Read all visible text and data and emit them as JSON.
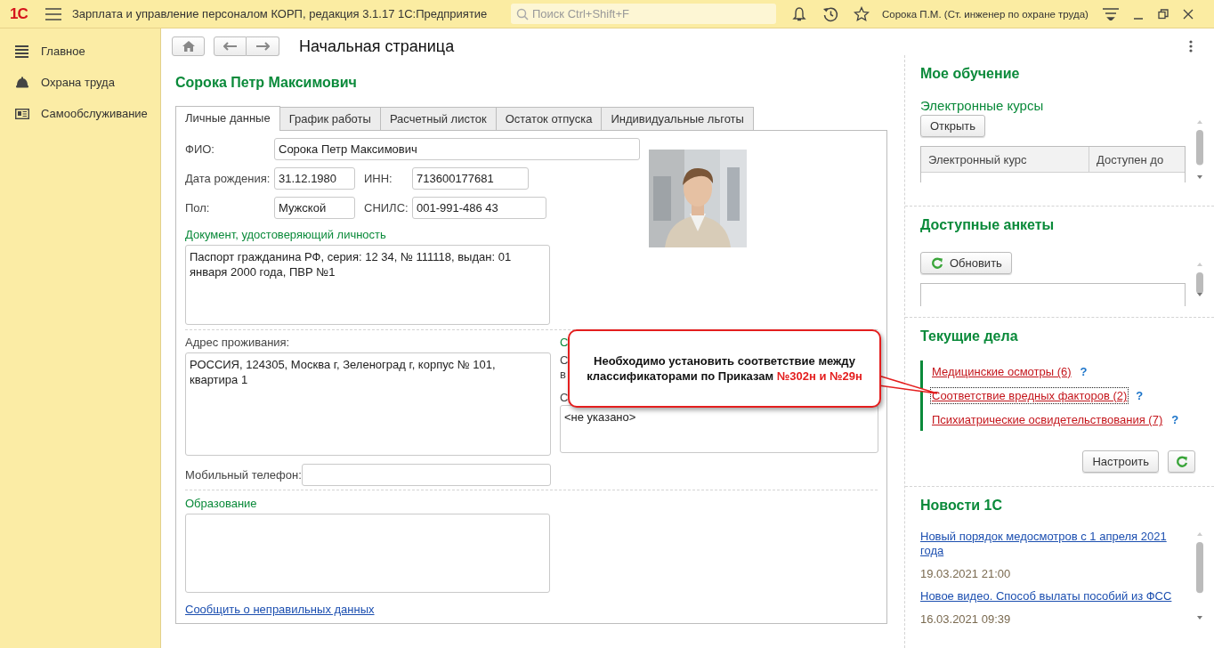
{
  "app": {
    "logo": "1С",
    "title": "Зарплата и управление персоналом КОРП, редакция 3.1.17 1С:Предприятие",
    "search": {
      "placeholder": "Поиск Ctrl+Shift+F"
    },
    "user": "Сорока П.М. (Ст. инженер по охране труда)"
  },
  "sidebar": {
    "items": [
      {
        "label": "Главное"
      },
      {
        "label": "Охрана труда"
      },
      {
        "label": "Самообслуживание"
      }
    ]
  },
  "page_title": "Начальная страница",
  "employee": {
    "name": "Сорока Петр Максимович",
    "tabs": [
      {
        "label": "Личные данные",
        "selected": true
      },
      {
        "label": "График работы",
        "selected": false
      },
      {
        "label": "Расчетный листок",
        "selected": false
      },
      {
        "label": "Остаток отпуска",
        "selected": false
      },
      {
        "label": "Индивидуальные льготы",
        "selected": false
      }
    ],
    "fio": {
      "label": "ФИО:",
      "value": "Сорока Петр Максимович"
    },
    "birth_date": {
      "label": "Дата рождения:",
      "value": "31.12.1980"
    },
    "inn": {
      "label": "ИНН:",
      "value": "713600177681"
    },
    "gender": {
      "label": "Пол:",
      "value": "Мужской"
    },
    "snils": {
      "label": "СНИЛС:",
      "value": "001-991-486 43"
    },
    "document": {
      "heading": "Документ, удостоверяющий личность",
      "value": "Паспорт гражданина РФ, серия: 12 34, № 111118, выдан: 01 января 2000 года, ПВР №1"
    },
    "address": {
      "label": "Адрес проживания:",
      "value": "РОССИЯ, 124305, Москва г, Зеленоград г, корпус № 101, квартира 1"
    },
    "covered_column": {
      "heading": "С",
      "labels": [
        "С",
        "в",
        "С"
      ],
      "value": "<не указано>"
    },
    "phone": {
      "label": "Мобильный телефон:"
    },
    "education": {
      "heading": "Образование"
    },
    "report_link": "Сообщить о неправильных данных"
  },
  "callout": {
    "text": "Необходимо установить соответствие между классификаторами по Приказам",
    "highlight": "№302н и №29н"
  },
  "learning": {
    "heading": "Мое обучение",
    "subheading": "Электронные курсы",
    "button": "Открыть",
    "columns": [
      "Электронный курс",
      "Доступен до"
    ]
  },
  "surveys": {
    "heading": "Доступные анкеты",
    "button": "Обновить"
  },
  "tasks": {
    "heading": "Текущие дела",
    "items": [
      {
        "label": "Медицинские осмотры (6)",
        "help": "?",
        "focused": false
      },
      {
        "label": "Соответствие вредных факторов (2)",
        "help": "?",
        "focused": true
      },
      {
        "label": "Психиатрические освидетельствования (7)",
        "help": "?",
        "focused": false
      }
    ],
    "button": "Настроить"
  },
  "news": {
    "heading": "Новости 1С",
    "items": [
      {
        "title": "Новый порядок медосмотров с 1 апреля 2021 года",
        "date": "19.03.2021 21:00"
      },
      {
        "title": "Новое видео. Способ вылаты пособий из ФСС",
        "date": "16.03.2021 09:39"
      }
    ]
  }
}
